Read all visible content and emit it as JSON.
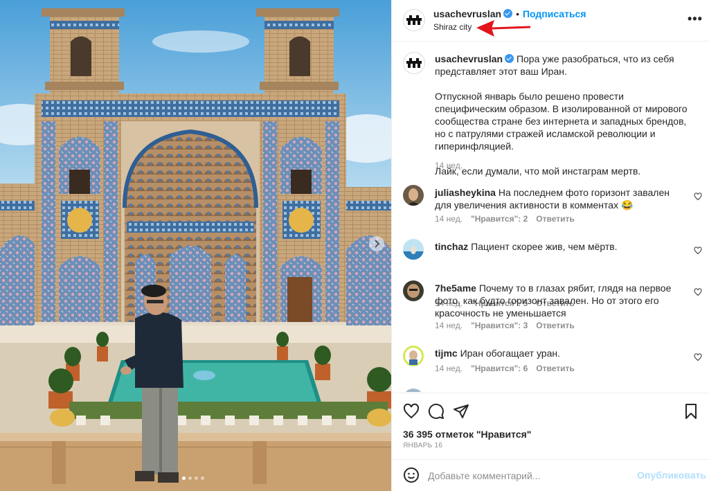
{
  "post": {
    "username": "usachevruslan",
    "verified": true,
    "follow_label": "Подписаться",
    "location": "Shiraz city",
    "more_label": "•••"
  },
  "caption": {
    "username": "usachevruslan",
    "paragraphs": [
      "Пора уже разобраться, что из себя представляет этот ваш Иран.",
      "Отпускной январь было решено провести специфическим образом. В изолированной от мирового сообщества стране без интернета и западных брендов, но с патрулями стражей исламской революции и гиперинфляцией.",
      "Лайк, если думали, что мой инстаграм мертв."
    ],
    "time": "14 нед."
  },
  "comments": [
    {
      "username": "juliasheykina",
      "text": "На последнем фото горизонт завален для увеличения активности в комментах 😂",
      "time": "14 нед.",
      "likes": "\"Нравится\": 2",
      "reply": "Ответить"
    },
    {
      "username": "tinchaz",
      "text": "Пациент скорее жив, чем мёртв.",
      "time": "14 нед.",
      "likes": "\"Нравится\": 5",
      "reply": "Ответить"
    },
    {
      "username": "7he5ame",
      "text": "Почему то в глазах рябит, глядя на первое фото, как будто горизонт завален. Но от этого его красочность не уменьшается",
      "time": "14 нед.",
      "likes": "\"Нравится\": 3",
      "reply": "Ответить"
    },
    {
      "username": "tijmc",
      "text": "Иран обогащает уран.",
      "time": "14 нед.",
      "likes": "\"Нравится\": 6",
      "reply": "Ответить"
    }
  ],
  "actions": {
    "likes_count": "36 395 отметок \"Нравится\"",
    "date": "ЯНВАРЬ 16",
    "icons": [
      "heart-icon",
      "comment-icon",
      "share-icon",
      "bookmark-icon"
    ]
  },
  "add_comment": {
    "placeholder": "Добавьте комментарий...",
    "publish_label": "Опубликовать"
  },
  "carousel": {
    "slide_count": 4,
    "active_index": 0
  },
  "colors": {
    "accent": "#0095f6",
    "publish_disabled": "#b2dffc",
    "annotation_arrow": "#e3141b"
  }
}
